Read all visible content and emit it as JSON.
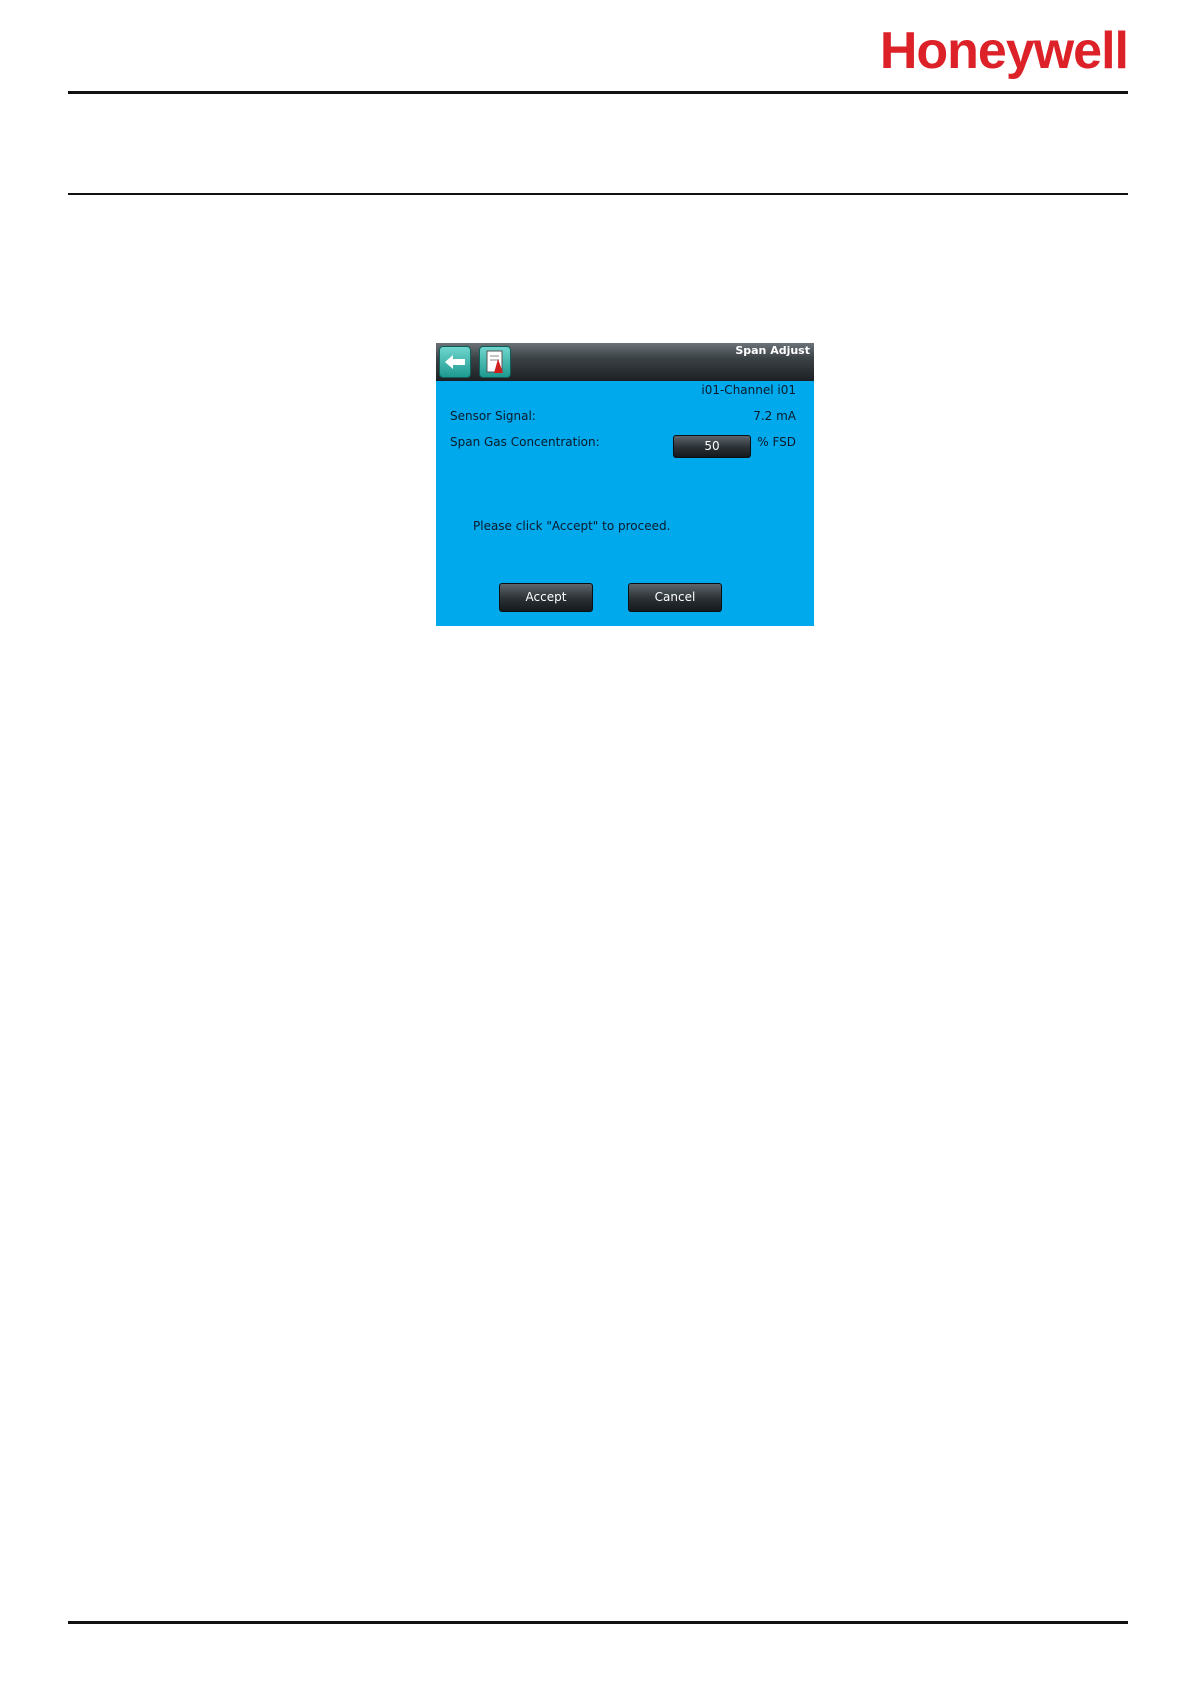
{
  "header": {
    "logo_text": "Honeywell",
    "brand_color": "#dc2128"
  },
  "screen": {
    "title": "Span Adjust",
    "back_icon": "back-arrow-icon",
    "doc_icon": "document-icon",
    "channel": "i01-Channel i01",
    "sensor_signal_label": "Sensor Signal:",
    "sensor_signal_value": "7.2 mA",
    "span_gas_label": "Span Gas Concentration:",
    "span_gas_value": "50",
    "span_gas_unit": "% FSD",
    "prompt": "Please click \"Accept\" to proceed.",
    "accept_label": "Accept",
    "cancel_label": "Cancel",
    "background_color": "#00a8ec"
  }
}
